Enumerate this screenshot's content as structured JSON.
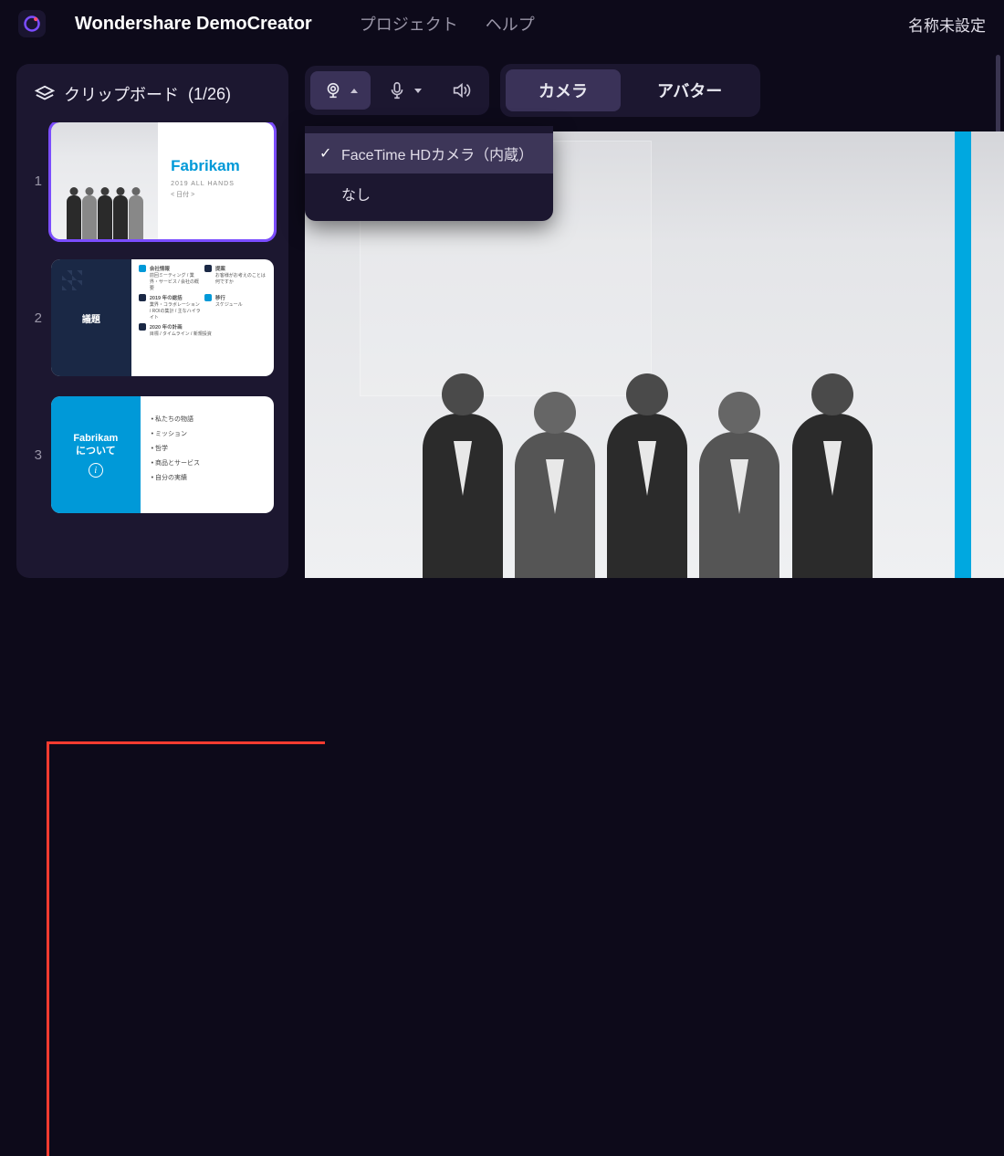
{
  "app": {
    "name": "Wondershare DemoCreator",
    "doc_title": "名称未設定"
  },
  "menu": {
    "project": "プロジェクト",
    "help": "ヘルプ"
  },
  "sidebar": {
    "header": "クリップボード",
    "counter": "(1/26)"
  },
  "slides": [
    {
      "index": "1",
      "company": "Fabrikam",
      "subtitle": "2019 ALL HANDS",
      "date_placeholder": "< 日付 >"
    },
    {
      "index": "2",
      "title": "議題",
      "agenda": [
        {
          "head": "会社情報",
          "sub": "前回ミーティング / 業界・サービス / 会社の概要"
        },
        {
          "head": "提案",
          "sub": "お客様がお考えのことは何ですか"
        },
        {
          "head": "2019 年の総括",
          "sub": "業界・コラボレーション / ROIの集計 / 主なハイライト"
        },
        {
          "head": "移行",
          "sub": "スケジュール"
        },
        {
          "head": "2020 年の計画",
          "sub": "目標 / タイムライン / 新規投資"
        }
      ]
    },
    {
      "index": "3",
      "title_top": "Fabrikam",
      "title_bottom": "について",
      "bullets": [
        "私たちの物語",
        "ミッション",
        "哲学",
        "商品とサービス",
        "自分の実績"
      ]
    }
  ],
  "toolbar": {
    "camera_icon": "camera",
    "mic_icon": "microphone",
    "speaker_icon": "speaker"
  },
  "mode_tabs": {
    "camera": "カメラ",
    "avatar": "アバター"
  },
  "camera_dropdown": {
    "options": [
      {
        "label": "FaceTime HDカメラ（内蔵）",
        "selected": true,
        "highlight": true
      },
      {
        "label": "なし",
        "selected": false,
        "highlight": false
      }
    ]
  }
}
